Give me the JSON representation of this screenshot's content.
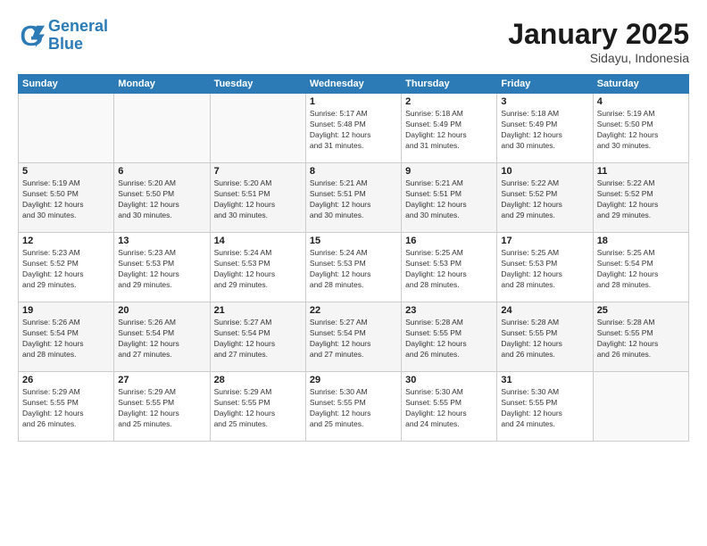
{
  "logo": {
    "line1": "General",
    "line2": "Blue"
  },
  "title": "January 2025",
  "subtitle": "Sidayu, Indonesia",
  "headers": [
    "Sunday",
    "Monday",
    "Tuesday",
    "Wednesday",
    "Thursday",
    "Friday",
    "Saturday"
  ],
  "weeks": [
    [
      {
        "date": "",
        "info": ""
      },
      {
        "date": "",
        "info": ""
      },
      {
        "date": "",
        "info": ""
      },
      {
        "date": "1",
        "info": "Sunrise: 5:17 AM\nSunset: 5:48 PM\nDaylight: 12 hours\nand 31 minutes."
      },
      {
        "date": "2",
        "info": "Sunrise: 5:18 AM\nSunset: 5:49 PM\nDaylight: 12 hours\nand 31 minutes."
      },
      {
        "date": "3",
        "info": "Sunrise: 5:18 AM\nSunset: 5:49 PM\nDaylight: 12 hours\nand 30 minutes."
      },
      {
        "date": "4",
        "info": "Sunrise: 5:19 AM\nSunset: 5:50 PM\nDaylight: 12 hours\nand 30 minutes."
      }
    ],
    [
      {
        "date": "5",
        "info": "Sunrise: 5:19 AM\nSunset: 5:50 PM\nDaylight: 12 hours\nand 30 minutes."
      },
      {
        "date": "6",
        "info": "Sunrise: 5:20 AM\nSunset: 5:50 PM\nDaylight: 12 hours\nand 30 minutes."
      },
      {
        "date": "7",
        "info": "Sunrise: 5:20 AM\nSunset: 5:51 PM\nDaylight: 12 hours\nand 30 minutes."
      },
      {
        "date": "8",
        "info": "Sunrise: 5:21 AM\nSunset: 5:51 PM\nDaylight: 12 hours\nand 30 minutes."
      },
      {
        "date": "9",
        "info": "Sunrise: 5:21 AM\nSunset: 5:51 PM\nDaylight: 12 hours\nand 30 minutes."
      },
      {
        "date": "10",
        "info": "Sunrise: 5:22 AM\nSunset: 5:52 PM\nDaylight: 12 hours\nand 29 minutes."
      },
      {
        "date": "11",
        "info": "Sunrise: 5:22 AM\nSunset: 5:52 PM\nDaylight: 12 hours\nand 29 minutes."
      }
    ],
    [
      {
        "date": "12",
        "info": "Sunrise: 5:23 AM\nSunset: 5:52 PM\nDaylight: 12 hours\nand 29 minutes."
      },
      {
        "date": "13",
        "info": "Sunrise: 5:23 AM\nSunset: 5:53 PM\nDaylight: 12 hours\nand 29 minutes."
      },
      {
        "date": "14",
        "info": "Sunrise: 5:24 AM\nSunset: 5:53 PM\nDaylight: 12 hours\nand 29 minutes."
      },
      {
        "date": "15",
        "info": "Sunrise: 5:24 AM\nSunset: 5:53 PM\nDaylight: 12 hours\nand 28 minutes."
      },
      {
        "date": "16",
        "info": "Sunrise: 5:25 AM\nSunset: 5:53 PM\nDaylight: 12 hours\nand 28 minutes."
      },
      {
        "date": "17",
        "info": "Sunrise: 5:25 AM\nSunset: 5:53 PM\nDaylight: 12 hours\nand 28 minutes."
      },
      {
        "date": "18",
        "info": "Sunrise: 5:25 AM\nSunset: 5:54 PM\nDaylight: 12 hours\nand 28 minutes."
      }
    ],
    [
      {
        "date": "19",
        "info": "Sunrise: 5:26 AM\nSunset: 5:54 PM\nDaylight: 12 hours\nand 28 minutes."
      },
      {
        "date": "20",
        "info": "Sunrise: 5:26 AM\nSunset: 5:54 PM\nDaylight: 12 hours\nand 27 minutes."
      },
      {
        "date": "21",
        "info": "Sunrise: 5:27 AM\nSunset: 5:54 PM\nDaylight: 12 hours\nand 27 minutes."
      },
      {
        "date": "22",
        "info": "Sunrise: 5:27 AM\nSunset: 5:54 PM\nDaylight: 12 hours\nand 27 minutes."
      },
      {
        "date": "23",
        "info": "Sunrise: 5:28 AM\nSunset: 5:55 PM\nDaylight: 12 hours\nand 26 minutes."
      },
      {
        "date": "24",
        "info": "Sunrise: 5:28 AM\nSunset: 5:55 PM\nDaylight: 12 hours\nand 26 minutes."
      },
      {
        "date": "25",
        "info": "Sunrise: 5:28 AM\nSunset: 5:55 PM\nDaylight: 12 hours\nand 26 minutes."
      }
    ],
    [
      {
        "date": "26",
        "info": "Sunrise: 5:29 AM\nSunset: 5:55 PM\nDaylight: 12 hours\nand 26 minutes."
      },
      {
        "date": "27",
        "info": "Sunrise: 5:29 AM\nSunset: 5:55 PM\nDaylight: 12 hours\nand 25 minutes."
      },
      {
        "date": "28",
        "info": "Sunrise: 5:29 AM\nSunset: 5:55 PM\nDaylight: 12 hours\nand 25 minutes."
      },
      {
        "date": "29",
        "info": "Sunrise: 5:30 AM\nSunset: 5:55 PM\nDaylight: 12 hours\nand 25 minutes."
      },
      {
        "date": "30",
        "info": "Sunrise: 5:30 AM\nSunset: 5:55 PM\nDaylight: 12 hours\nand 24 minutes."
      },
      {
        "date": "31",
        "info": "Sunrise: 5:30 AM\nSunset: 5:55 PM\nDaylight: 12 hours\nand 24 minutes."
      },
      {
        "date": "",
        "info": ""
      }
    ]
  ]
}
